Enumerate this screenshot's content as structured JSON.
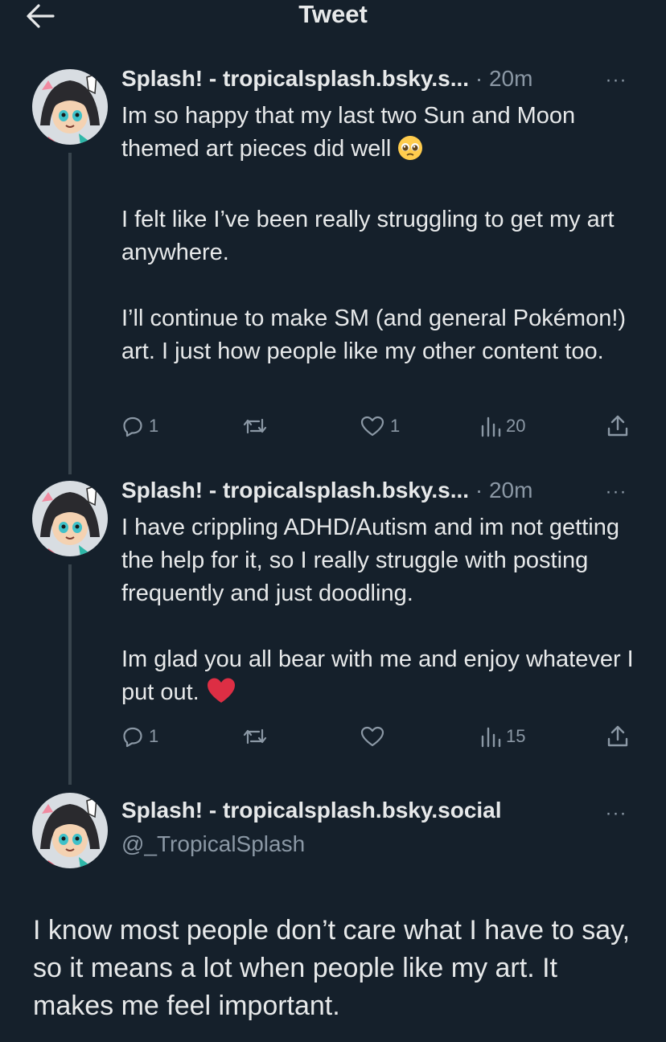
{
  "header": {
    "title": "Tweet"
  },
  "tweets": [
    {
      "author": "Splash! - tropicalsplash.bsky.s...",
      "separator": "·",
      "time": "20m",
      "more": "···",
      "text": [
        "Im so happy that my last two Sun and Moon themed art pieces did well",
        "I felt like I’ve been really struggling to get my art anywhere.",
        "I’ll continue to make SM (and general Pokémon!) art. I just how people like my other content too."
      ],
      "emoji": "pleading-face",
      "replies": "1",
      "retweets": "",
      "likes": "1",
      "views": "20"
    },
    {
      "author": "Splash! - tropicalsplash.bsky.s...",
      "separator": "·",
      "time": "20m",
      "more": "···",
      "text": [
        "I have crippling ADHD/Autism and im not getting the help for it, so I really struggle with posting frequently and just doodling.",
        "Im glad you all bear with me and enjoy whatever I put out."
      ],
      "emoji": "red-heart",
      "replies": "1",
      "retweets": "",
      "likes": "",
      "views": "15"
    }
  ],
  "main_tweet": {
    "author": "Splash! - tropicalsplash.bsky.social",
    "handle": "@_TropicalSplash",
    "more": "···",
    "text": "I know most people don’t care what I have to say, so it means a lot when people like my art. It makes me feel important."
  },
  "colors": {
    "background": "#15202b",
    "text": "#e7e9ea",
    "muted": "#8b98a5",
    "thread_line": "#38444d"
  },
  "icons": [
    "back-arrow-icon",
    "reply-icon",
    "retweet-icon",
    "like-icon",
    "views-icon",
    "share-icon",
    "more-icon"
  ]
}
